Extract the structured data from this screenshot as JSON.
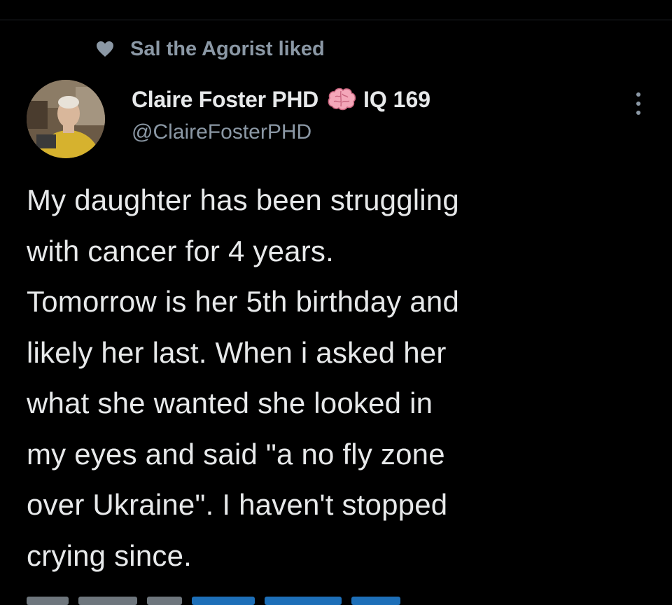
{
  "social_context": {
    "icon": "heart-icon",
    "text": "Sal the Agorist liked"
  },
  "author": {
    "avatar_icon": "avatar",
    "display_name": "Claire Foster PHD",
    "name_emoji": "brain-icon",
    "iq_label": "IQ 169",
    "handle": "@ClaireFosterPHD"
  },
  "tweet": {
    "text": "My daughter has been struggling\nwith cancer for 4 years.\nTomorrow is her 5th birthday and\nlikely her last. When i asked her\nwhat she wanted she looked in\nmy eyes and said \"a no fly zone\nover Ukraine\". I haven't stopped\ncrying since."
  },
  "menu": {
    "icon": "more-options-icon"
  },
  "colors": {
    "background": "#000000",
    "primary_text": "#e7e9ea",
    "secondary_text": "#8b98a5"
  }
}
